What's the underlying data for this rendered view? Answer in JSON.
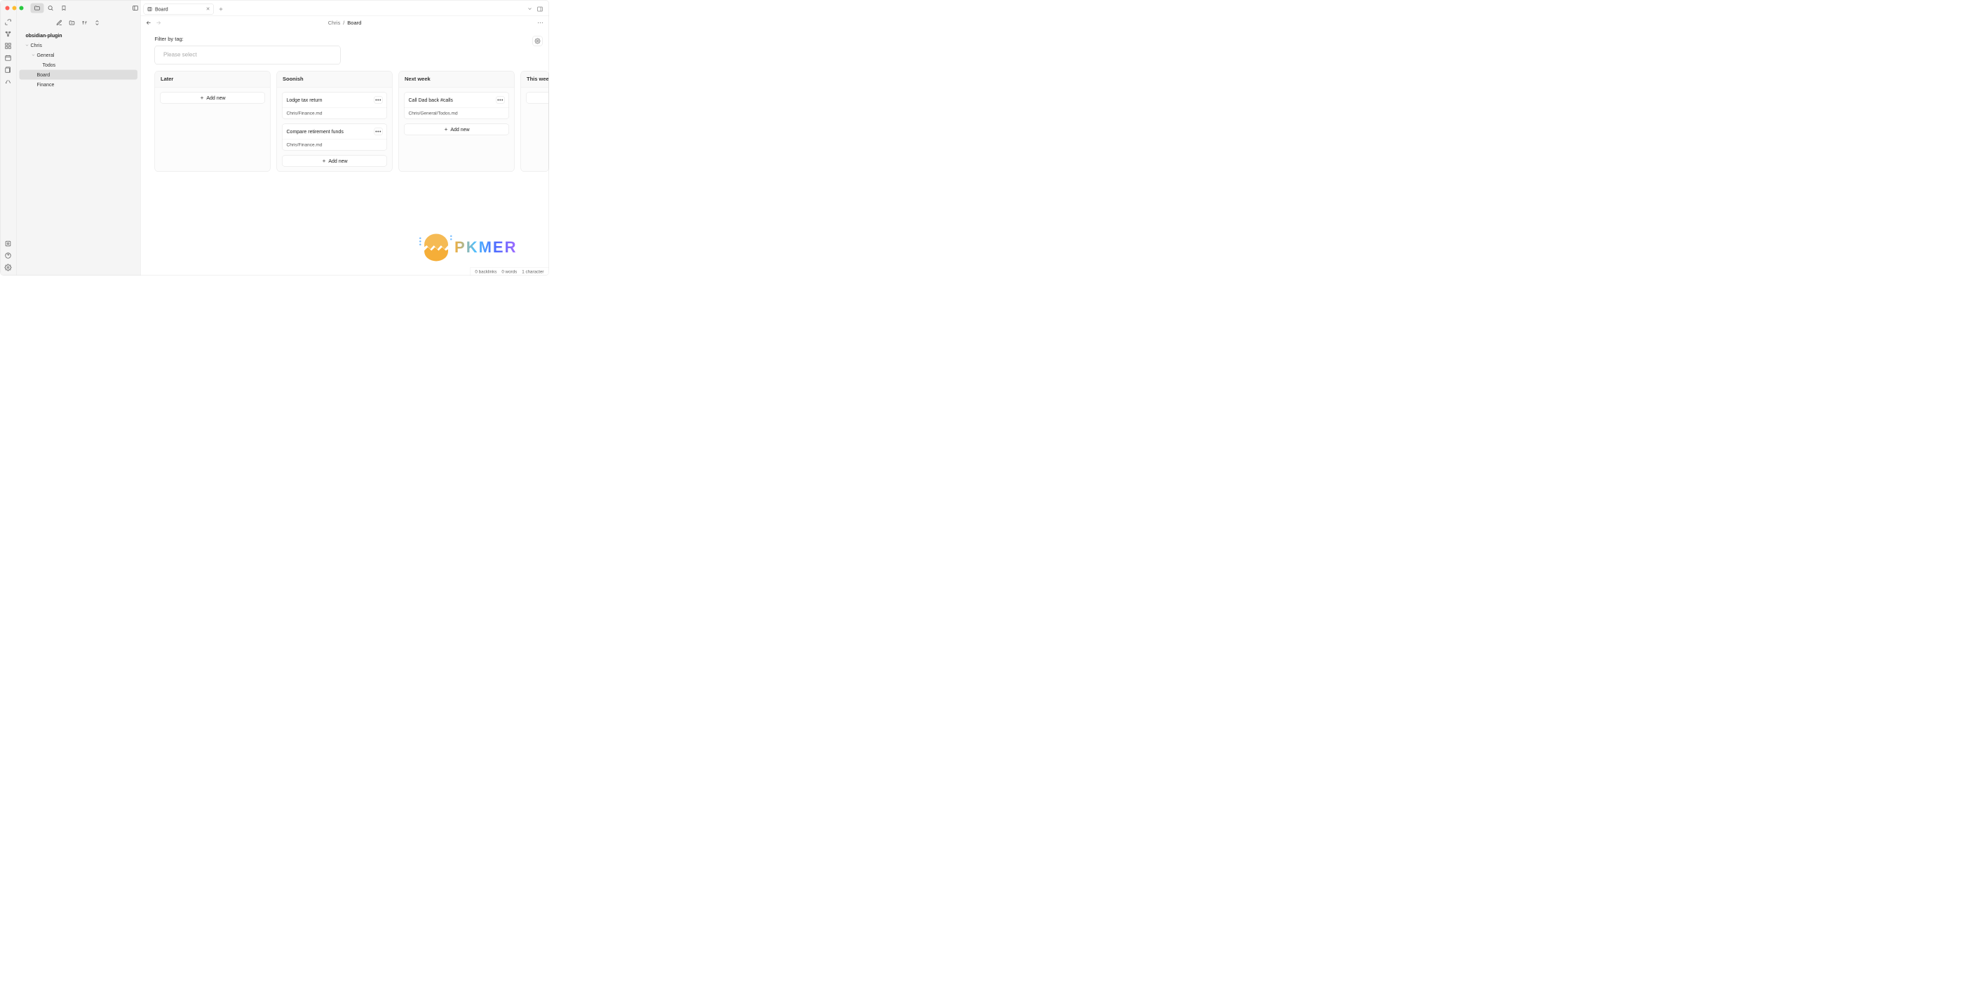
{
  "titlebar": {
    "active_tab": "Board"
  },
  "sidebar": {
    "vault_name": "obsidian-plugin",
    "tree": [
      {
        "label": "Chris",
        "depth": 0,
        "expandable": true
      },
      {
        "label": "General",
        "depth": 1,
        "expandable": true
      },
      {
        "label": "Todos",
        "depth": 2,
        "expandable": false
      },
      {
        "label": "Board",
        "depth": 1,
        "expandable": false,
        "selected": true
      },
      {
        "label": "Finance",
        "depth": 1,
        "expandable": false
      }
    ]
  },
  "breadcrumb": {
    "parent": "Chris",
    "sep": "/",
    "current": "Board"
  },
  "filter": {
    "label": "Filter by tag:",
    "placeholder": "Please select"
  },
  "columns": [
    {
      "title": "Later",
      "cards": []
    },
    {
      "title": "Soonish",
      "cards": [
        {
          "title": "Lodge tax return",
          "path": "Chris/Finance.md"
        },
        {
          "title": "Compare retirement funds",
          "path": "Chris/Finance.md"
        }
      ]
    },
    {
      "title": "Next week",
      "cards": [
        {
          "title": "Call Dad back #calls",
          "path": "Chris/General/Todos.md"
        }
      ]
    },
    {
      "title": "This week",
      "cards": []
    }
  ],
  "addnew": "Add new",
  "watermark": "PKMER",
  "status": {
    "backlinks": "0 backlinks",
    "words": "0 words",
    "chars": "1 character"
  }
}
